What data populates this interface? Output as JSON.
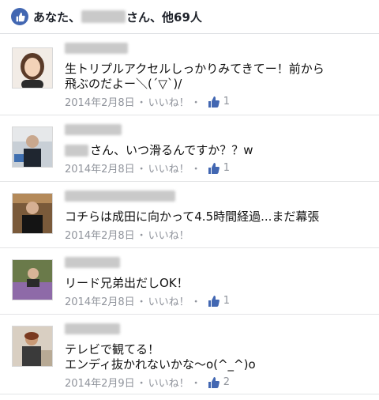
{
  "header": {
    "prefix": "あなた、",
    "suffix": "さん、他69人"
  },
  "comments": [
    {
      "text": "生トリプルアクセルしっかりみてきてー！前から\n飛ぶのだよー＼(´▽`)/",
      "date": "2014年2月8日",
      "like_label": "いいね！",
      "likes": "1"
    },
    {
      "text": "さん、いつ滑るんですか？？w",
      "date": "2014年2月8日",
      "like_label": "いいね！",
      "likes": "1"
    },
    {
      "text": "コチらは成田に向かって4.5時間経過...まだ幕張",
      "date": "2014年2月8日",
      "like_label": "いいね！",
      "likes": ""
    },
    {
      "text": "リード兄弟出だしOK！",
      "date": "2014年2月8日",
      "like_label": "いいね！",
      "likes": "1"
    },
    {
      "text": "テレビで観てる！\nエンディ抜かれないかな〜o(^_^)o",
      "date": "2014年2月9日",
      "like_label": "いいね！",
      "likes": "2"
    }
  ],
  "colors": {
    "accent": "#4267b2",
    "meta": "#90949c"
  }
}
